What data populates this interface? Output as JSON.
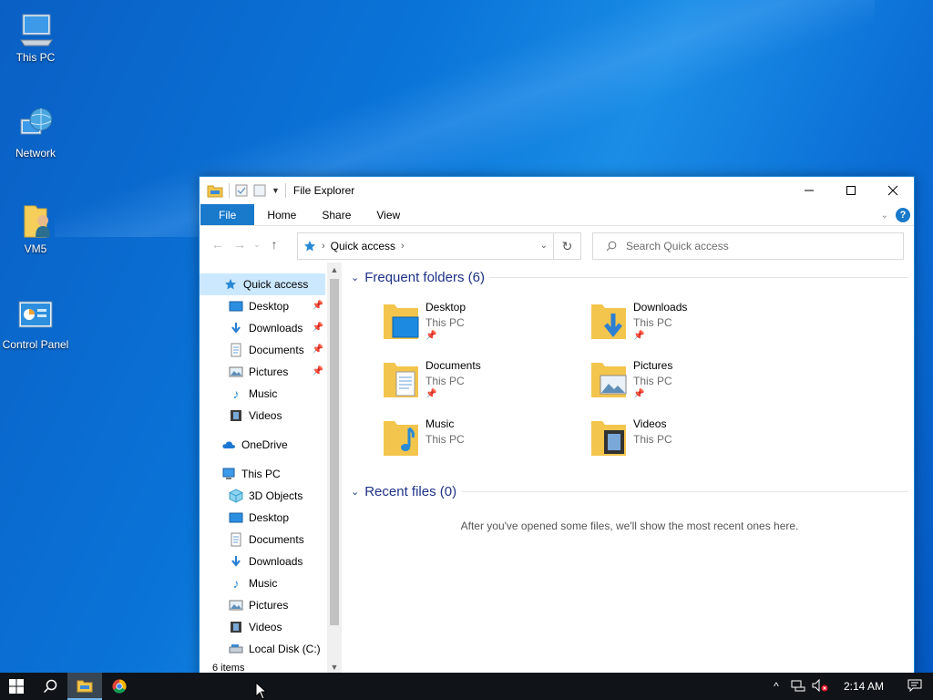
{
  "desktop": {
    "icons": [
      {
        "label": "This PC"
      },
      {
        "label": "Network"
      },
      {
        "label": "VM5"
      },
      {
        "label": "Control Panel"
      }
    ]
  },
  "window": {
    "title": "File Explorer",
    "ribbon": {
      "file": "File",
      "home": "Home",
      "share": "Share",
      "view": "View",
      "help": "?"
    },
    "address": {
      "crumb": "Quick access"
    },
    "search": {
      "placeholder": "Search Quick access"
    },
    "nav": {
      "quick_access": "Quick access",
      "quick_items": [
        "Desktop",
        "Downloads",
        "Documents",
        "Pictures",
        "Music",
        "Videos"
      ],
      "onedrive": "OneDrive",
      "this_pc": "This PC",
      "pc_items": [
        "3D Objects",
        "Desktop",
        "Documents",
        "Downloads",
        "Music",
        "Pictures",
        "Videos",
        "Local Disk (C:)"
      ]
    },
    "frequent": {
      "header": "Frequent folders (6)",
      "folders": [
        {
          "name": "Desktop",
          "location": "This PC"
        },
        {
          "name": "Downloads",
          "location": "This PC"
        },
        {
          "name": "Documents",
          "location": "This PC"
        },
        {
          "name": "Pictures",
          "location": "This PC"
        },
        {
          "name": "Music",
          "location": "This PC"
        },
        {
          "name": "Videos",
          "location": "This PC"
        }
      ]
    },
    "recent": {
      "header": "Recent files (0)",
      "empty_message": "After you've opened some files, we'll show the most recent ones here."
    },
    "status": "6 items"
  },
  "taskbar": {
    "clock": "2:14 AM"
  },
  "colors": {
    "accent": "#1979ca",
    "selection": "#cce8ff",
    "group_header": "#1e3287",
    "taskbar": "#101418"
  }
}
